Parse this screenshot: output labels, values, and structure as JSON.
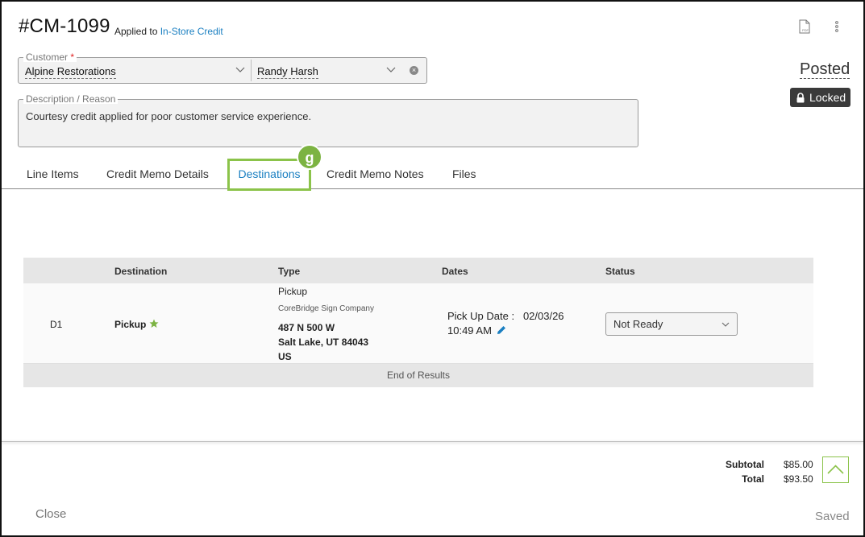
{
  "header": {
    "title": "#CM-1099",
    "applied_prefix": "Applied to",
    "applied_link": "In-Store Credit",
    "pdf_icon": "pdf-icon",
    "menu_icon": "kebab-menu-icon"
  },
  "customer": {
    "label": "Customer",
    "required_mark": "*",
    "company": "Alpine Restorations",
    "contact": "Randy Harsh"
  },
  "description": {
    "label": "Description / Reason",
    "value": "Courtesy credit applied for poor customer service experience."
  },
  "status_panel": {
    "status": "Posted",
    "locked_label": "Locked"
  },
  "tabs": [
    {
      "label": "Line Items"
    },
    {
      "label": "Credit Memo Details"
    },
    {
      "label": "Destinations",
      "active": true
    },
    {
      "label": "Credit Memo Notes"
    },
    {
      "label": "Files"
    }
  ],
  "callout_badge": "g",
  "table": {
    "columns": [
      "Destination",
      "Type",
      "Dates",
      "Status"
    ],
    "rows": [
      {
        "id": "D1",
        "destination": "Pickup",
        "type": "Pickup",
        "company": "CoreBridge Sign Company",
        "address1": "487 N 500 W",
        "address2": "Salt Lake, UT 84043",
        "country": "US",
        "date_label": "Pick Up Date :",
        "date": "02/03/26",
        "time": "10:49 AM",
        "status": "Not Ready"
      }
    ],
    "end_text": "End of Results"
  },
  "totals": {
    "subtotal_label": "Subtotal",
    "subtotal_value": "$85.00",
    "total_label": "Total",
    "total_value": "$93.50"
  },
  "footer": {
    "close_label": "Close",
    "saved_label": "Saved"
  },
  "colors": {
    "accent_green": "#8bc34a",
    "link_blue": "#1a7fc1",
    "star_green": "#7cb342",
    "locked_bg": "#3a3a3a"
  }
}
